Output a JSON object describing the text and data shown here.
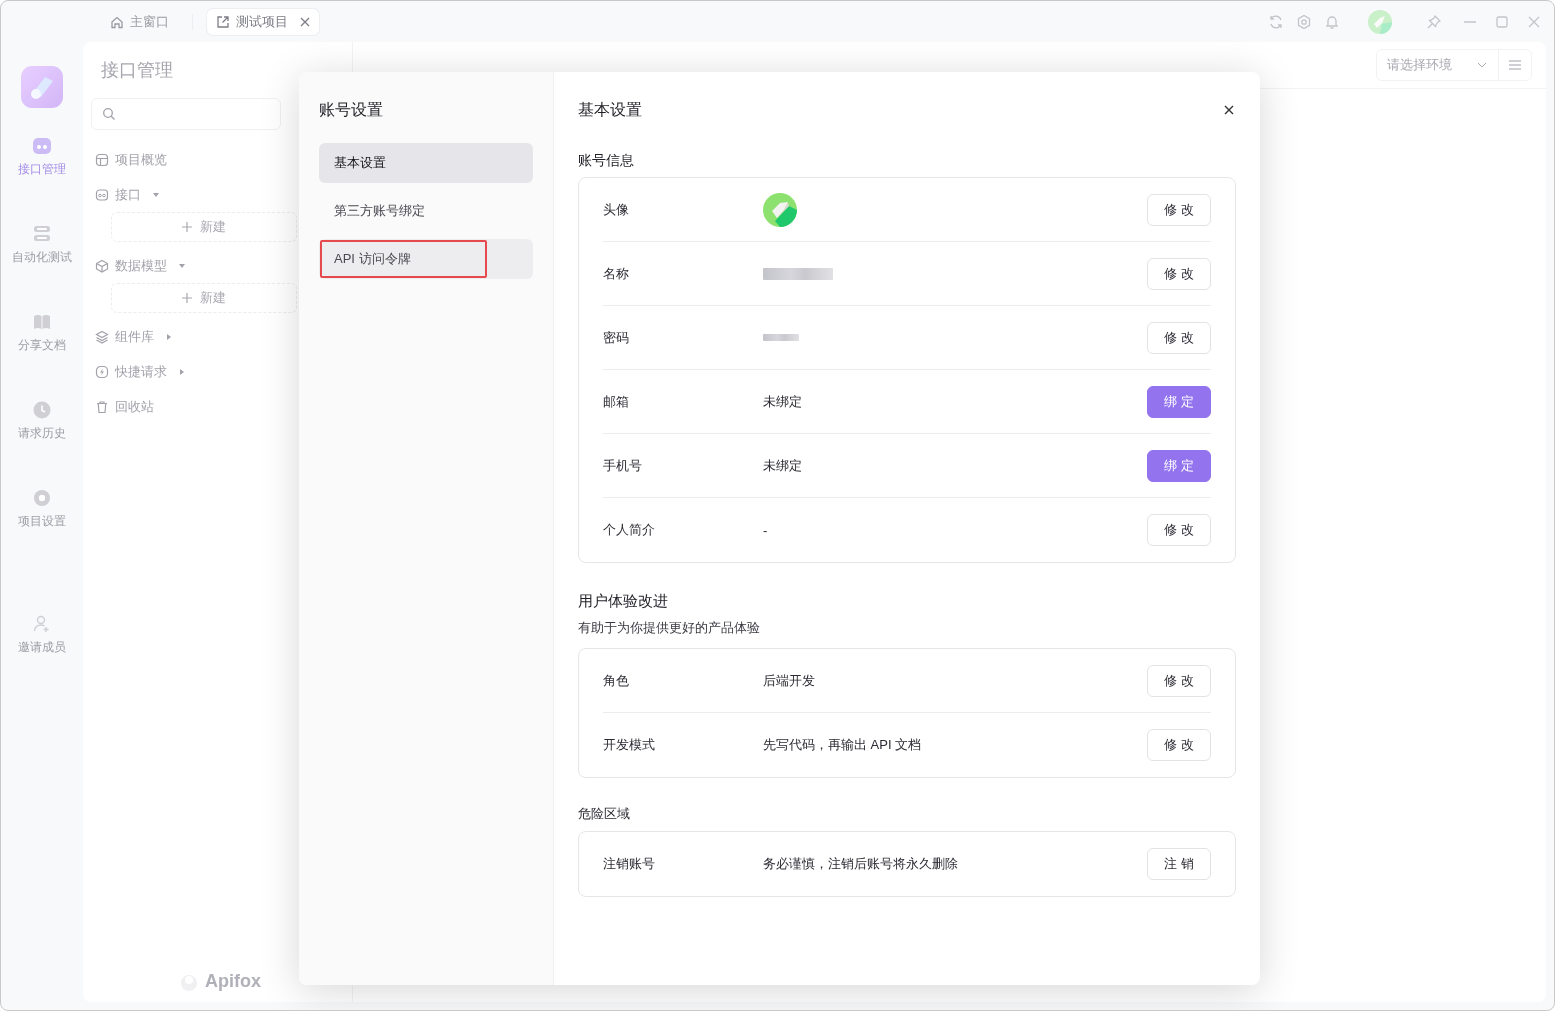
{
  "window": {
    "tabs": [
      {
        "label": "主窗口",
        "selected": false,
        "closable": false
      },
      {
        "label": "测试项目",
        "selected": true,
        "closable": true
      }
    ]
  },
  "nav_rail": {
    "items": [
      {
        "label": "接口管理",
        "selected": true
      },
      {
        "label": "自动化测试",
        "selected": false
      },
      {
        "label": "分享文档",
        "selected": false
      },
      {
        "label": "请求历史",
        "selected": false
      },
      {
        "label": "项目设置",
        "selected": false
      },
      {
        "label": "邀请成员",
        "selected": false
      }
    ]
  },
  "project": {
    "title": "接口管理",
    "tree": [
      {
        "label": "项目概览"
      },
      {
        "label": "接口",
        "expanded": true,
        "new_label": "新建"
      },
      {
        "label": "数据模型",
        "expanded": true,
        "new_label": "新建"
      },
      {
        "label": "组件库",
        "expanded": false
      },
      {
        "label": "快捷请求",
        "expanded": false
      },
      {
        "label": "回收站"
      }
    ],
    "brand": "Apifox"
  },
  "workspace": {
    "environment": {
      "placeholder": "请选择环境"
    }
  },
  "modal": {
    "title": "账号设置",
    "menu": [
      {
        "label": "基本设置",
        "selected": true,
        "hovered": false,
        "annotated": false
      },
      {
        "label": "第三方账号绑定",
        "selected": false,
        "hovered": false,
        "annotated": false
      },
      {
        "label": "API 访问令牌",
        "selected": false,
        "hovered": true,
        "annotated": true
      }
    ],
    "panel_title": "基本设置",
    "sections": [
      {
        "title": "账号信息",
        "rows": [
          {
            "label": "头像",
            "kind": "avatar",
            "action": "修 改",
            "primary": false
          },
          {
            "label": "名称",
            "kind": "blurred",
            "action": "修 改",
            "primary": false
          },
          {
            "label": "密码",
            "kind": "masked",
            "action": "修 改",
            "primary": false
          },
          {
            "label": "邮箱",
            "kind": "text",
            "value": "未绑定",
            "action": "绑 定",
            "primary": true
          },
          {
            "label": "手机号",
            "kind": "text",
            "value": "未绑定",
            "action": "绑 定",
            "primary": true
          },
          {
            "label": "个人简介",
            "kind": "text",
            "value": "-",
            "action": "修 改",
            "primary": false
          }
        ]
      },
      {
        "title": "用户体验改进",
        "subtitle": "有助于为你提供更好的产品体验",
        "rows": [
          {
            "label": "角色",
            "kind": "text",
            "value": "后端开发",
            "action": "修 改",
            "primary": false
          },
          {
            "label": "开发模式",
            "kind": "text",
            "value": "先写代码，再输出 API 文档",
            "action": "修 改",
            "primary": false
          }
        ]
      },
      {
        "title": "危险区域",
        "rows": [
          {
            "label": "注销账号",
            "kind": "text",
            "value": "务必谨慎，注销后账号将永久删除",
            "action": "注 销",
            "primary": false
          }
        ]
      }
    ]
  }
}
